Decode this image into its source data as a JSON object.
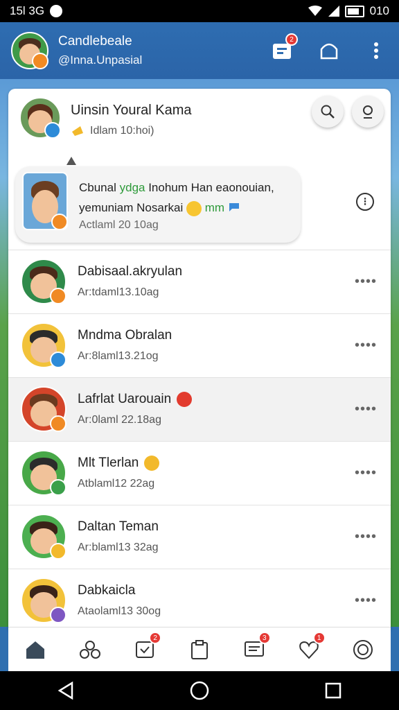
{
  "status": {
    "time": "15l 3G",
    "battery": "010"
  },
  "topbar": {
    "title": "Candlebeale",
    "subtitle": "@Inna.Unpasial",
    "calendar_badge": "2"
  },
  "header": {
    "name": "Uinsin Youral Kama",
    "status": "Idlam 10:hoi)"
  },
  "message": {
    "line1_a": "Cbunal ",
    "line1_green": "ydga",
    "line1_b": " Inohum Han eaonouian,",
    "line2_a": "yemuniam Nosarkai ",
    "line2_green": "mm",
    "time": "Actlaml 20 10ag"
  },
  "contacts": [
    {
      "name": "Dabisaal.akryulan",
      "time": "Ar:tdaml13.10ag",
      "alt": false,
      "emoji": ""
    },
    {
      "name": "Mndma Obralan",
      "time": "Ar:8laml13.21og",
      "alt": false,
      "emoji": ""
    },
    {
      "name": "Lafrlat Uarouain",
      "time": "Ar:0laml 22.18ag",
      "alt": true,
      "emoji": "red"
    },
    {
      "name": "Mlt Tlerlan",
      "time": "Atblaml12 22ag",
      "alt": false,
      "emoji": "face"
    },
    {
      "name": "Daltan Teman",
      "time": "Ar:blaml13 32ag",
      "alt": false,
      "emoji": ""
    },
    {
      "name": "Dabkaicla",
      "time": "Ataolaml13 30og",
      "alt": false,
      "emoji": ""
    }
  ],
  "nav_badges": {
    "inbox": "2",
    "chat": "3",
    "heart": "1"
  },
  "colors": {
    "header": "#2e6db1",
    "badge": "#e53935",
    "green": "#2e9a3a"
  }
}
